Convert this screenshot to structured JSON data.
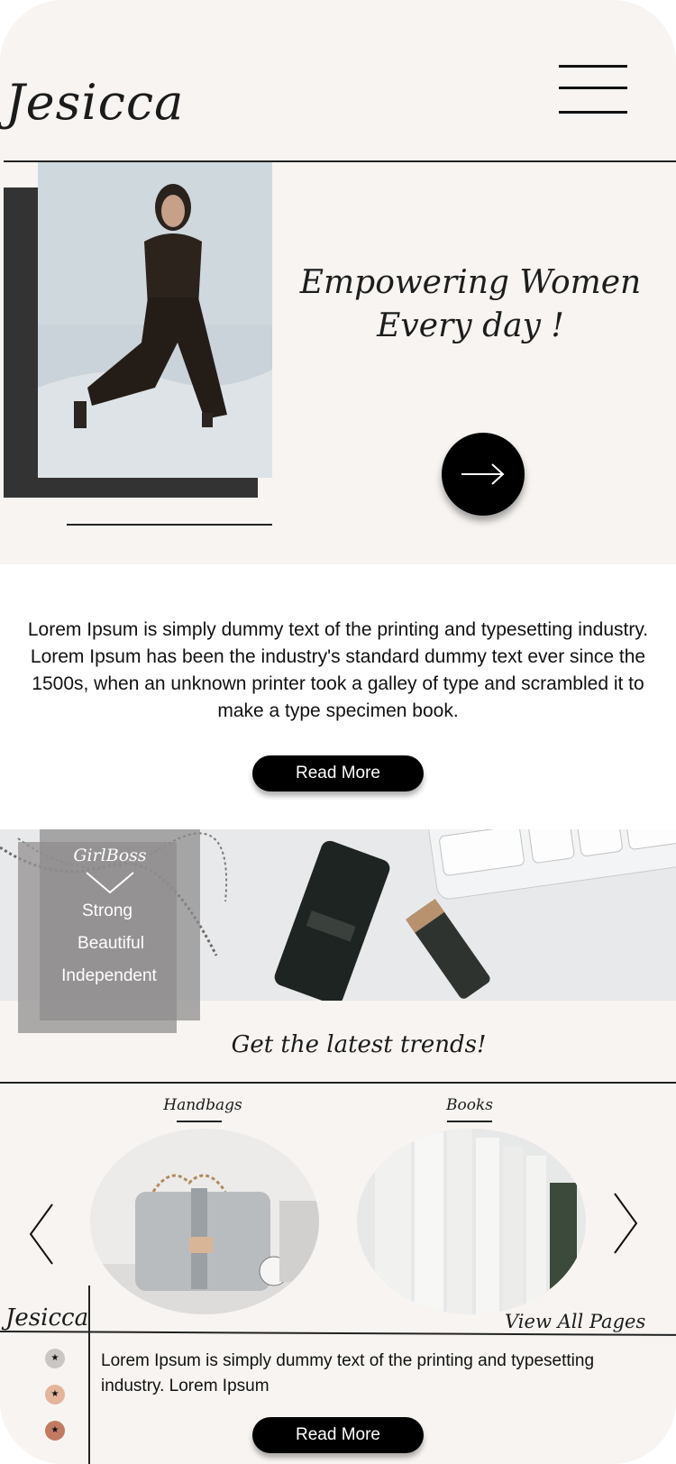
{
  "brand": {
    "logo": "Jesicca",
    "footer_logo": "Jesicca"
  },
  "header": {
    "menu_icon": "hamburger-menu-icon"
  },
  "hero": {
    "title": "Empowering Women Every day !",
    "cta_icon": "arrow-right-icon"
  },
  "intro": {
    "text": "Lorem Ipsum is simply dummy text of the printing and typesetting industry. Lorem Ipsum has been the industry's standard dummy text ever since the 1500s, when an unknown printer took a galley of type and scrambled it to make a type specimen book.",
    "button": "Read More"
  },
  "girlboss": {
    "title": "GirlBoss",
    "items": [
      "Strong",
      "Beautiful",
      "Independent"
    ]
  },
  "trends": {
    "title": "Get the latest trends!",
    "categories": [
      {
        "label": "Handbags"
      },
      {
        "label": "Books"
      }
    ],
    "prev_icon": "chevron-left-icon",
    "next_icon": "chevron-right-icon"
  },
  "footer": {
    "view_all": "View All Pages",
    "text": "Lorem Ipsum is simply dummy text of the printing and typesetting industry. Lorem Ipsum",
    "button": "Read More",
    "dots": [
      {
        "color": "#c9c6c4",
        "icon": "star-icon"
      },
      {
        "color": "#e4b49b",
        "icon": "star-icon"
      },
      {
        "color": "#c27a62",
        "icon": "star-icon"
      }
    ]
  },
  "colors": {
    "background": "#f7f4f1",
    "accent": "#000000",
    "panel": "#333333"
  }
}
